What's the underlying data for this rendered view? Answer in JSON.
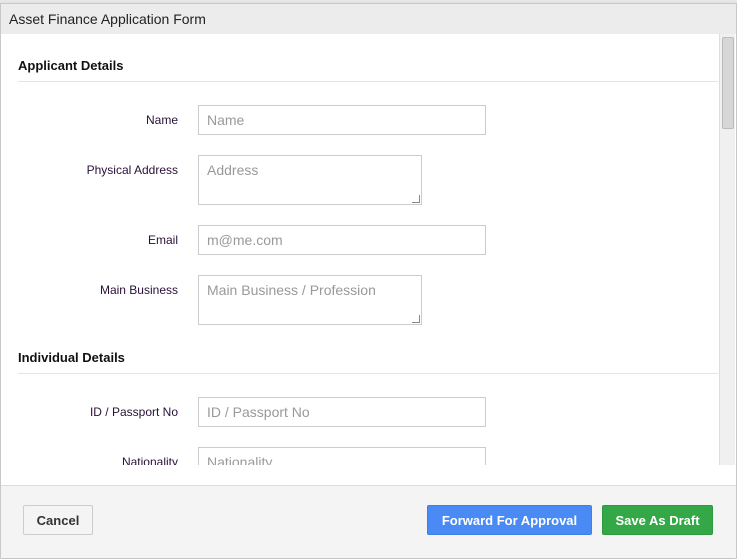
{
  "dialog": {
    "title": "Asset Finance Application Form"
  },
  "sections": [
    {
      "title": "Applicant Details",
      "fields": [
        {
          "label": "Name",
          "placeholder": "Name"
        },
        {
          "label": "Physical Address",
          "placeholder": "Address"
        },
        {
          "label": "Email",
          "placeholder": "m@me.com"
        },
        {
          "label": "Main Business",
          "placeholder": "Main Business / Profession"
        }
      ]
    },
    {
      "title": "Individual Details",
      "fields": [
        {
          "label": "ID / Passport No",
          "placeholder": "ID / Passport No"
        },
        {
          "label": "Nationality",
          "placeholder": "Nationality"
        }
      ]
    }
  ],
  "footer": {
    "cancel": "Cancel",
    "forward": "Forward For Approval",
    "save": "Save As Draft"
  },
  "colors": {
    "forward": "#4a8af4",
    "save": "#34a847"
  }
}
